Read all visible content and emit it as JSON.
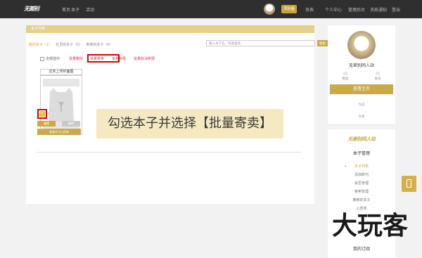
{
  "header": {
    "logo": "无差别",
    "nav": [
      "首页",
      "本子",
      "活动"
    ],
    "user_badge": "同好圈",
    "menu": [
      "发表",
      "个人中心",
      "管理后台",
      "消息通知",
      "登出"
    ]
  },
  "panel": {
    "title": "本子列表",
    "tabs": [
      "我的本子（1）",
      "社员的本子（0）",
      "寄卖的本子（0）"
    ],
    "search_placeholder": "输入本子名、快速查找",
    "search_button": "搜索",
    "select_all": "全部选中",
    "bulk_actions": [
      "批量删除",
      "批量寄卖",
      "批量参展",
      "批量取消参展"
    ],
    "card": {
      "title": "还未上传封面图",
      "edit": "编辑",
      "delete": "删除",
      "detail": "查看本子心愿单"
    },
    "instruction": "勾选本子并选择【批量寄卖】"
  },
  "sidebar": {
    "name": "无差别同人站",
    "stats": [
      "粉丝",
      "关注"
    ],
    "home_button": "查看主页",
    "links": [
      "作品",
      "文章"
    ],
    "menu_logo": "无差别同人站",
    "menu_title": "本子管理",
    "menu_items": [
      "本子列表",
      "添加新刊",
      "会否管理",
      "寄卖管理",
      "推荐的本子",
      "心愿单"
    ],
    "subscription": "我的订阅"
  },
  "watermark": "大玩客",
  "colors": {
    "accent": "#c9a94a",
    "highlight": "#dd0000",
    "link": "#d9426a"
  }
}
